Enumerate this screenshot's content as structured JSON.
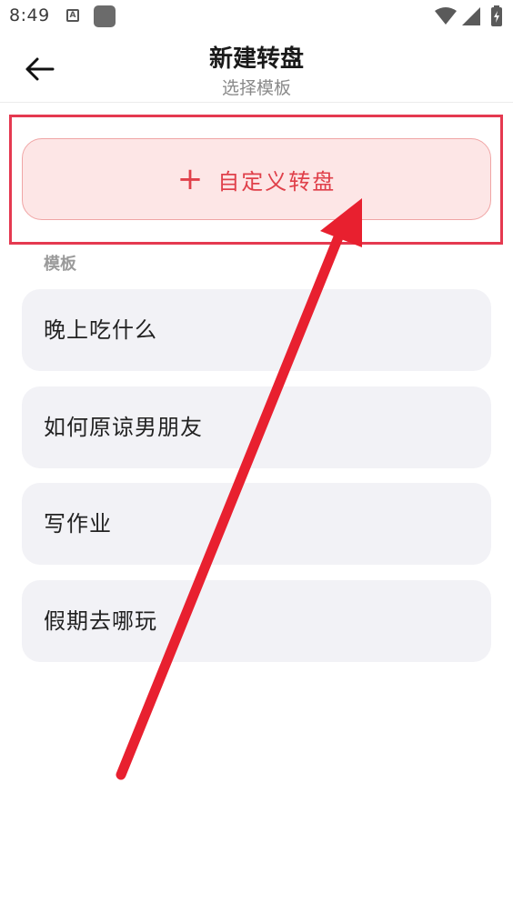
{
  "status_bar": {
    "time": "8:49",
    "notif_letter": "A",
    "icons": [
      "notification-a-icon",
      "app-square-icon",
      "wifi-icon",
      "signal-icon",
      "battery-icon"
    ]
  },
  "header": {
    "back_icon": "back-arrow-icon",
    "title": "新建转盘",
    "subtitle": "选择模板"
  },
  "custom_button": {
    "icon": "plus-icon",
    "plus_symbol": "+",
    "label": "自定义转盘"
  },
  "templates_section": {
    "label": "模板",
    "items": [
      {
        "label": "晚上吃什么"
      },
      {
        "label": "如何原谅男朋友"
      },
      {
        "label": "写作业"
      },
      {
        "label": "假期去哪玩"
      }
    ]
  },
  "colors": {
    "accent": "#e0404a",
    "accent_bg": "#fde6e6",
    "highlight": "#e53950",
    "item_bg": "#f2f2f6",
    "annotation": "#e8202f"
  }
}
